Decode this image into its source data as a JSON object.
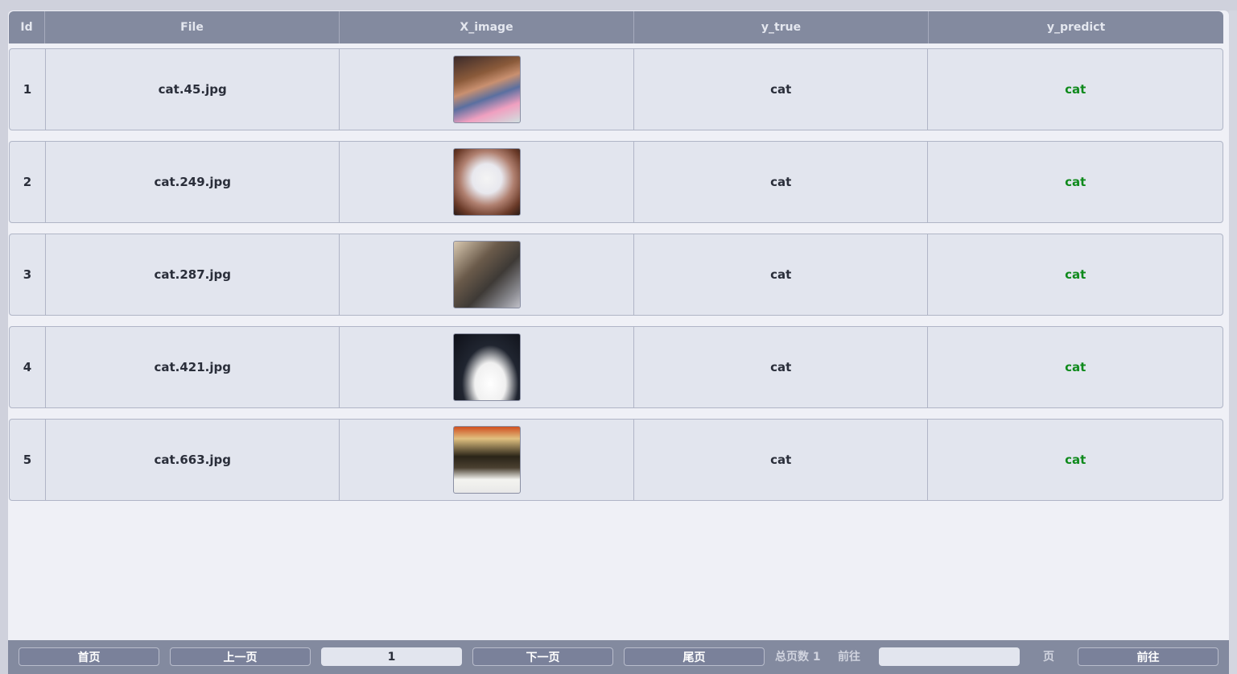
{
  "table": {
    "headers": [
      "Id",
      "File",
      "X_image",
      "y_true",
      "y_predict"
    ],
    "rows": [
      {
        "id": "1",
        "file": "cat.45.jpg",
        "image_icon": "cat-photo-icon",
        "y_true": "cat",
        "y_predict": "cat"
      },
      {
        "id": "2",
        "file": "cat.249.jpg",
        "image_icon": "cat-photo-icon",
        "y_true": "cat",
        "y_predict": "cat"
      },
      {
        "id": "3",
        "file": "cat.287.jpg",
        "image_icon": "cat-photo-icon",
        "y_true": "cat",
        "y_predict": "cat"
      },
      {
        "id": "4",
        "file": "cat.421.jpg",
        "image_icon": "cat-photo-icon",
        "y_true": "cat",
        "y_predict": "cat"
      },
      {
        "id": "5",
        "file": "cat.663.jpg",
        "image_icon": "cat-photo-icon",
        "y_true": "cat",
        "y_predict": "cat"
      }
    ]
  },
  "pagination": {
    "first_label": "首页",
    "prev_label": "上一页",
    "current_page": "1",
    "next_label": "下一页",
    "last_label": "尾页",
    "total_pages_text": "总页数 1",
    "goto_prefix": "前往",
    "goto_value": "",
    "goto_suffix": "页",
    "goto_button": "前往"
  },
  "colors": {
    "header_bg": "#838a9f",
    "row_bg": "#e2e5ee",
    "predict_color": "#0f8a1c",
    "page_bg": "#eff0f6"
  }
}
